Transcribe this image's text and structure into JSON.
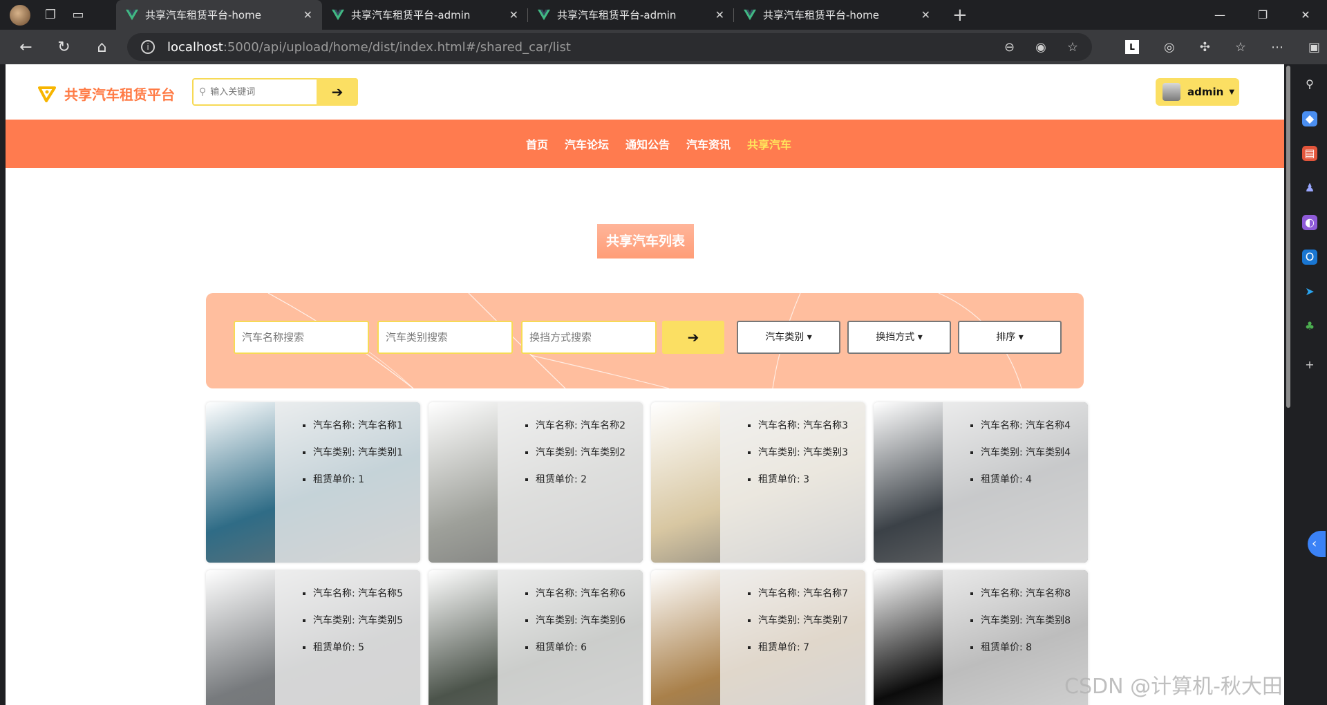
{
  "browser": {
    "tabs": [
      {
        "title": "共享汽车租赁平台-home",
        "active": true
      },
      {
        "title": "共享汽车租赁平台-admin",
        "active": false
      },
      {
        "title": "共享汽车租赁平台-admin",
        "active": false
      },
      {
        "title": "共享汽车租赁平台-home",
        "active": false
      }
    ],
    "url_host": "localhost",
    "url_rest": ":5000/api/upload/home/dist/index.html#/shared_car/list"
  },
  "site": {
    "name": "共享汽车租赁平台",
    "search_placeholder": "输入关键词",
    "user": "admin"
  },
  "nav": [
    "首页",
    "汽车论坛",
    "通知公告",
    "汽车资讯",
    "共享汽车"
  ],
  "nav_active": "共享汽车",
  "list_title": "共享汽车列表",
  "filters": {
    "name_placeholder": "汽车名称搜索",
    "type_placeholder": "汽车类别搜索",
    "gear_placeholder": "换挡方式搜索",
    "dropdowns": [
      "汽车类别",
      "换挡方式",
      "排序"
    ]
  },
  "field_labels": {
    "name": "汽车名称:",
    "type": "汽车类别:",
    "price": "租赁单价:"
  },
  "cars": [
    {
      "name": "汽车名称1",
      "type": "汽车类别1",
      "price": "1",
      "color": "#2f6c86"
    },
    {
      "name": "汽车名称2",
      "type": "汽车类别2",
      "price": "2",
      "color": "#9ea09a"
    },
    {
      "name": "汽车名称3",
      "type": "汽车类别3",
      "price": "3",
      "color": "#d8c7a2"
    },
    {
      "name": "汽车名称4",
      "type": "汽车类别4",
      "price": "4",
      "color": "#3b4147"
    },
    {
      "name": "汽车名称5",
      "type": "汽车类别5",
      "price": "5",
      "color": "#777a7d"
    },
    {
      "name": "汽车名称6",
      "type": "汽车类别6",
      "price": "6",
      "color": "#4c544b"
    },
    {
      "name": "汽车名称7",
      "type": "汽车类别7",
      "price": "7",
      "color": "#a9804a"
    },
    {
      "name": "汽车名称8",
      "type": "汽车类别8",
      "price": "8",
      "color": "#0b0b0b"
    }
  ],
  "watermark": "CSDN @计算机-秋大田"
}
